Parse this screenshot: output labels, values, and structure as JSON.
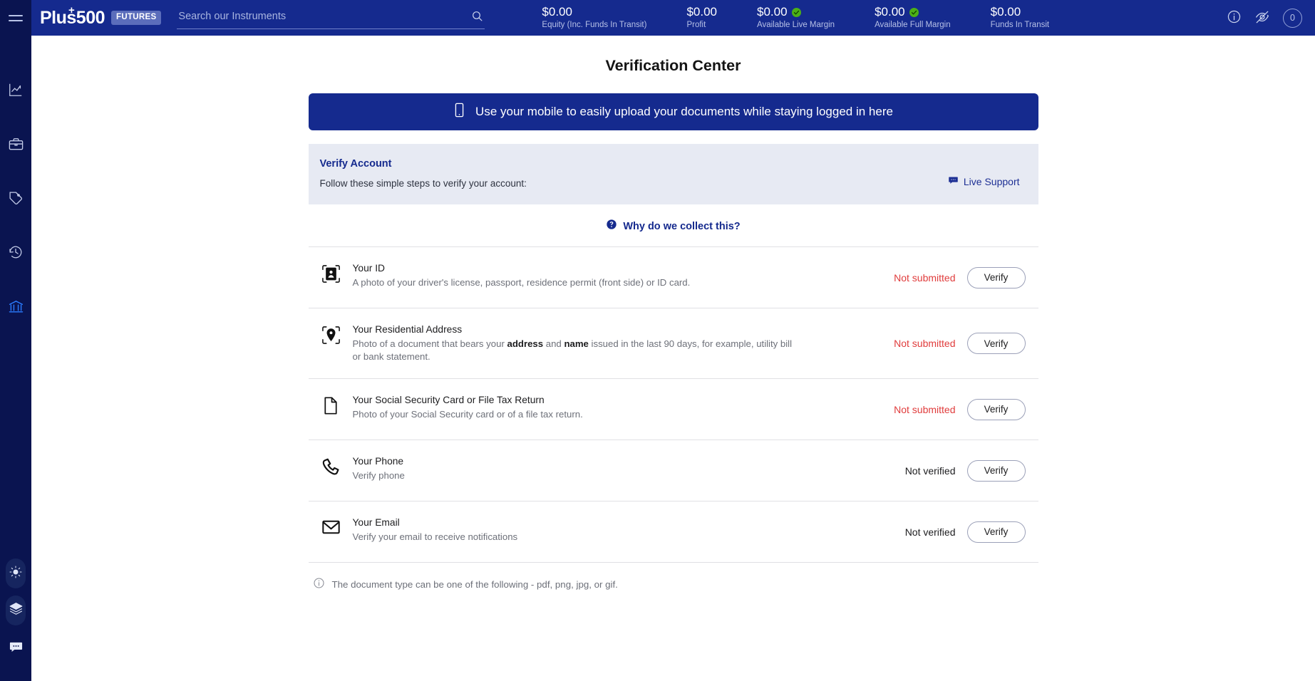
{
  "sidebar": {
    "menu_icon": "hamburger-icon",
    "items": [
      {
        "icon": "chart-line-icon",
        "name": "markets",
        "active": false
      },
      {
        "icon": "briefcase-icon",
        "name": "portfolio",
        "active": false
      },
      {
        "icon": "tag-icon",
        "name": "orders",
        "active": false
      },
      {
        "icon": "history-clock-icon",
        "name": "history",
        "active": false
      },
      {
        "icon": "bank-icon",
        "name": "funds",
        "active": true
      }
    ],
    "bottom_items": [
      {
        "icon": "brightness-icon",
        "name": "theme-toggle"
      },
      {
        "icon": "layers-icon",
        "name": "layers"
      },
      {
        "icon": "chat-bubble-icon",
        "name": "chat"
      }
    ]
  },
  "header": {
    "logo": "Plus500",
    "logo_plus": "+",
    "badge": "FUTURES",
    "search": {
      "value": "",
      "placeholder": "Search our Instruments",
      "icon": "search-icon"
    },
    "stats": [
      {
        "value": "$0.00",
        "label": "Equity (Inc. Funds In Transit)",
        "verified": false
      },
      {
        "value": "$0.00",
        "label": "Profit",
        "verified": false
      },
      {
        "value": "$0.00",
        "label": "Available Live Margin",
        "verified": true
      },
      {
        "value": "$0.00",
        "label": "Available Full Margin",
        "verified": true
      },
      {
        "value": "$0.00",
        "label": "Funds In Transit",
        "verified": false
      }
    ],
    "info_icon": "info-circle-icon",
    "hide_icon": "eye-off-icon",
    "notification_count": "0"
  },
  "main": {
    "page_title": "Verification Center",
    "mobile_banner": {
      "icon": "mobile-phone-icon",
      "text": "Use your mobile to easily upload your documents while staying logged in here"
    },
    "verify_box": {
      "title": "Verify Account",
      "subtitle": "Follow these simple steps to verify your account:",
      "live_support_label": "Live Support",
      "live_support_icon": "chat-bubble-icon"
    },
    "why_link": {
      "icon": "question-circle-icon",
      "label": "Why do we collect this?"
    },
    "documents": [
      {
        "icon": "id-card-icon",
        "title": "Your ID",
        "desc_html": "A photo of your driver's license, passport, residence permit (front side) or ID card.",
        "status": "Not submitted",
        "status_type": "notsub",
        "action": "Verify"
      },
      {
        "icon": "location-pin-icon",
        "title": "Your Residential Address",
        "desc_html": "Photo of a document that bears your <b>address</b> and <b>name</b> issued in the last 90 days, for example, utility bill or bank statement.",
        "status": "Not submitted",
        "status_type": "notsub",
        "action": "Verify"
      },
      {
        "icon": "document-icon",
        "title": "Your Social Security Card or File Tax Return",
        "desc_html": "Photo of your Social Security card or of a file tax return.",
        "status": "Not submitted",
        "status_type": "notsub",
        "action": "Verify"
      },
      {
        "icon": "phone-icon",
        "title": "Your Phone",
        "desc_html": "Verify phone",
        "status": "Not verified",
        "status_type": "notver",
        "action": "Verify"
      },
      {
        "icon": "envelope-icon",
        "title": "Your Email",
        "desc_html": "Verify your email to receive notifications",
        "status": "Not verified",
        "status_type": "notver",
        "action": "Verify"
      }
    ],
    "footnote": {
      "icon": "info-circle-icon",
      "text": "The document type can be one of the following - pdf, png, jpg, or gif."
    }
  },
  "colors": {
    "sidebar_bg": "#0a1450",
    "header_bg": "#152a8e",
    "brand_blue": "#152a8e",
    "accent_active": "#2b7cff",
    "error_red": "#e03c3c",
    "verified_green": "#4caf16",
    "panel_bg": "#e7eaf3"
  }
}
